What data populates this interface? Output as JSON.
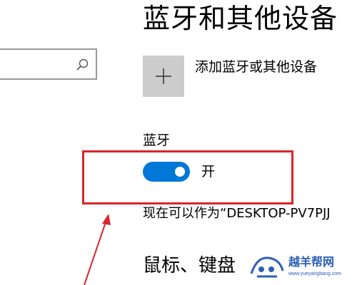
{
  "search": {
    "value": "",
    "placeholder": "",
    "icon": "search-icon"
  },
  "header": {
    "title": "蓝牙和其他设备"
  },
  "add_device": {
    "icon": "plus-icon",
    "label": "添加蓝牙或其他设备"
  },
  "bluetooth": {
    "heading": "蓝牙",
    "toggle_on": true,
    "toggle_state_label": "开",
    "discoverable_text": "现在可以作为“DESKTOP-PV7PJJ"
  },
  "next_section": {
    "heading": "鼠标、键盘"
  },
  "annotation": {
    "highlight_color": "#d9252b",
    "arrow_color": "#d9252b"
  },
  "watermark": {
    "name": "越羊帮网",
    "url": "www.yueyangbang.com"
  },
  "colors": {
    "accent": "#0078d7",
    "button_bg": "#cccccc",
    "search_border": "#999999",
    "watermark": "#2b5fb5"
  }
}
